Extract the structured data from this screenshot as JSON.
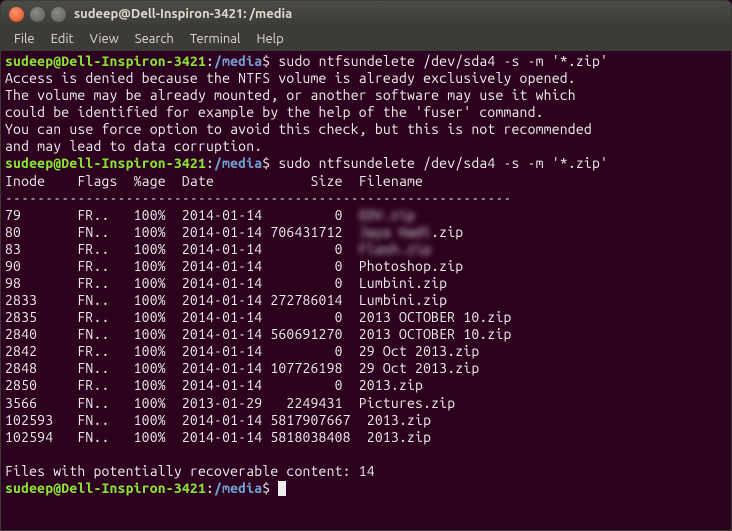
{
  "window": {
    "title": "sudeep@Dell-Inspiron-3421: /media"
  },
  "menu": {
    "file": "File",
    "edit": "Edit",
    "view": "View",
    "search": "Search",
    "terminal": "Terminal",
    "help": "Help"
  },
  "prompt": {
    "user_host": "sudeep@Dell-Inspiron-3421",
    "colon": ":",
    "path": "/media",
    "symbol": "$"
  },
  "commands": {
    "cmd1": " sudo ntfsundelete /dev/sda4 -s -m '*.zip'",
    "cmd2": " sudo ntfsundelete /dev/sda4 -s -m '*.zip'"
  },
  "err": {
    "l1": "Access is denied because the NTFS volume is already exclusively opened.",
    "l2": "The volume may be already mounted, or another software may use it which",
    "l3": "could be identified for example by the help of the 'fuser' command.",
    "l4": "You can use force option to avoid this check, but this is not recommended",
    "l5": "and may lead to data corruption."
  },
  "table": {
    "header": "Inode    Flags  %age  Date            Size  Filename",
    "sep": "---------------------------------------------------------------",
    "rows": [
      {
        "inode": "79",
        "flags": "FR..",
        "pct": "100%",
        "date": "2014-01-14",
        "size": "0",
        "fname": "EDV.zip",
        "blur": true
      },
      {
        "inode": "80",
        "flags": "FN..",
        "pct": "100%",
        "date": "2014-01-14",
        "size": "706431712",
        "fname": "Jaya Hadi.zip",
        "blur": true,
        "blurlen": 9
      },
      {
        "inode": "83",
        "flags": "FR..",
        "pct": "100%",
        "date": "2014-01-14",
        "size": "0",
        "fname": "Flash.zip",
        "blur": true
      },
      {
        "inode": "90",
        "flags": "FR..",
        "pct": "100%",
        "date": "2014-01-14",
        "size": "0",
        "fname": "Photoshop.zip"
      },
      {
        "inode": "98",
        "flags": "FR..",
        "pct": "100%",
        "date": "2014-01-14",
        "size": "0",
        "fname": "Lumbini.zip"
      },
      {
        "inode": "2833",
        "flags": "FN..",
        "pct": "100%",
        "date": "2014-01-14",
        "size": "272786014",
        "fname": "Lumbini.zip"
      },
      {
        "inode": "2835",
        "flags": "FR..",
        "pct": "100%",
        "date": "2014-01-14",
        "size": "0",
        "fname": "2013 OCTOBER 10.zip"
      },
      {
        "inode": "2840",
        "flags": "FN..",
        "pct": "100%",
        "date": "2014-01-14",
        "size": "560691270",
        "fname": "2013 OCTOBER 10.zip"
      },
      {
        "inode": "2842",
        "flags": "FR..",
        "pct": "100%",
        "date": "2014-01-14",
        "size": "0",
        "fname": "29 Oct 2013.zip"
      },
      {
        "inode": "2848",
        "flags": "FN..",
        "pct": "100%",
        "date": "2014-01-14",
        "size": "107726198",
        "fname": "29 Oct 2013.zip"
      },
      {
        "inode": "2850",
        "flags": "FR..",
        "pct": "100%",
        "date": "2014-01-14",
        "size": "0",
        "fname": "2013.zip"
      },
      {
        "inode": "3566",
        "flags": "FN..",
        "pct": "100%",
        "date": "2013-01-29",
        "size": "2249431",
        "fname": "Pictures.zip"
      },
      {
        "inode": "102593",
        "flags": "FN..",
        "pct": "100%",
        "date": "2014-01-14",
        "size": "5817907667",
        "fname": "2013.zip"
      },
      {
        "inode": "102594",
        "flags": "FN..",
        "pct": "100%",
        "date": "2014-01-14",
        "size": "5818038408",
        "fname": "2013.zip"
      }
    ]
  },
  "footer": {
    "recoverable": "Files with potentially recoverable content: 14"
  }
}
